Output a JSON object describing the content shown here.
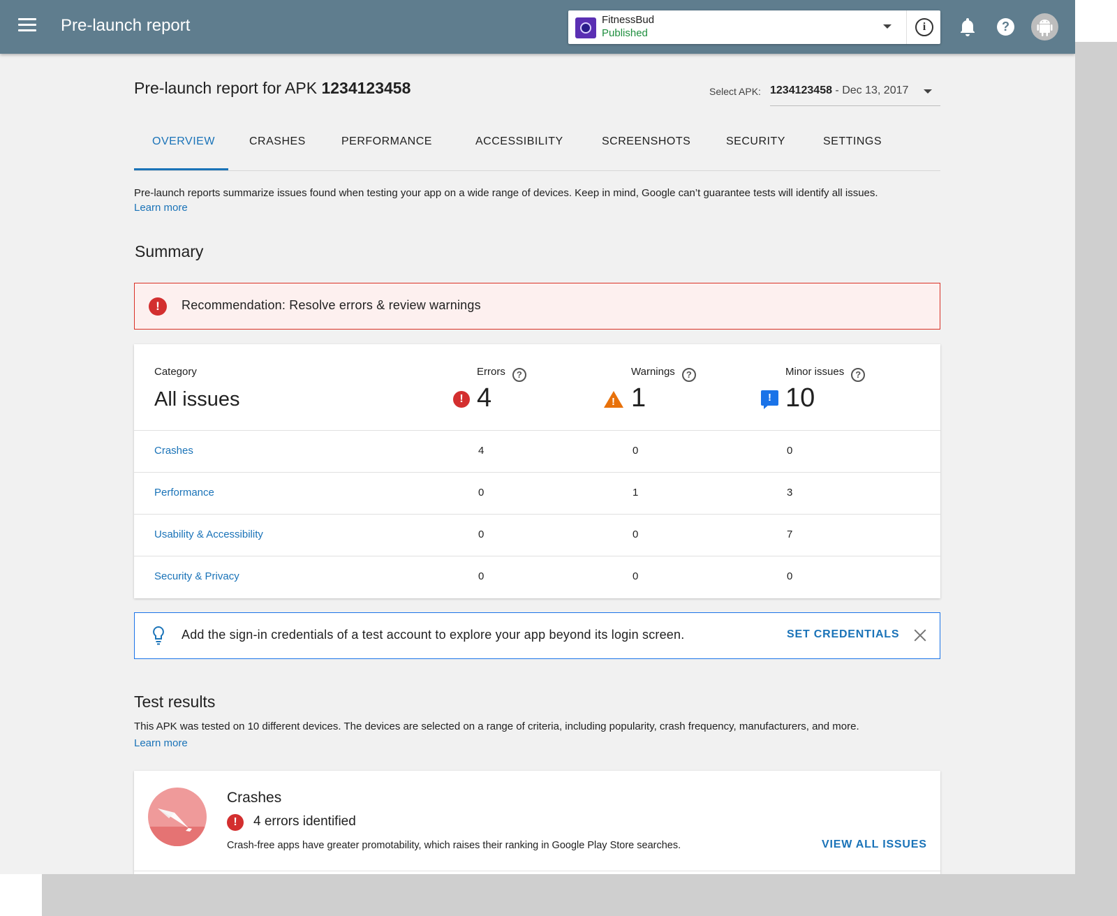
{
  "topbar": {
    "title": "Pre-launch report",
    "app_name": "FitnessBud",
    "app_status": "Published",
    "icons": [
      "menu-icon",
      "info-icon",
      "bell-icon",
      "help-icon",
      "android-avatar"
    ]
  },
  "header": {
    "title_prefix": "Pre-launch report for APK ",
    "apk_id": "1234123458",
    "select_label": "Select APK:",
    "select_apk_id": "1234123458",
    "select_date": " - Dec 13, 2017"
  },
  "tabs": [
    {
      "label": "OVERVIEW",
      "active": true
    },
    {
      "label": "CRASHES"
    },
    {
      "label": "PERFORMANCE"
    },
    {
      "label": "ACCESSIBILITY"
    },
    {
      "label": "SCREENSHOTS"
    },
    {
      "label": "SECURITY"
    },
    {
      "label": "SETTINGS"
    }
  ],
  "intro": {
    "text": "Pre-launch reports summarize issues found when testing your app on a wide range of devices. Keep in mind, Google can’t guarantee tests will identify all issues.",
    "learn_more": "Learn more"
  },
  "summary": {
    "heading": "Summary",
    "recommendation": "Recommendation: Resolve errors & review warnings",
    "category_label": "Category",
    "category_value": "All issues",
    "errors_label": "Errors",
    "warnings_label": "Warnings",
    "minor_label": "Minor issues",
    "errors_total": "4",
    "warnings_total": "1",
    "minor_total": "10",
    "rows": [
      {
        "name": "Crashes",
        "errors": "4",
        "warnings": "0",
        "minor": "0"
      },
      {
        "name": "Performance",
        "errors": "0",
        "warnings": "1",
        "minor": "3"
      },
      {
        "name": "Usability & Accessibility",
        "errors": "0",
        "warnings": "0",
        "minor": "7"
      },
      {
        "name": "Security & Privacy",
        "errors": "0",
        "warnings": "0",
        "minor": "0"
      }
    ]
  },
  "credentials_banner": {
    "text": "Add the sign-in credentials of a test account to explore your app beyond its login screen.",
    "action": "SET CREDENTIALS"
  },
  "test_results": {
    "heading": "Test results",
    "description": "This APK was tested on 10 different devices. The devices are selected on a range of criteria, including popularity, crash frequency, manufacturers, and more.",
    "learn_more": "Learn more",
    "crashes_card": {
      "title": "Crashes",
      "count_text": "4 errors identified",
      "description": "Crash-free apps have greater promotability, which raises their ranking in Google Play Store searches.",
      "action": "VIEW ALL ISSUES"
    }
  },
  "colors": {
    "topbar": "#5f7d8e",
    "accent": "#1a73b8",
    "error": "#d32f2f",
    "warning": "#e8710a",
    "minor": "#1a73e8",
    "published": "#1e8e3e"
  }
}
